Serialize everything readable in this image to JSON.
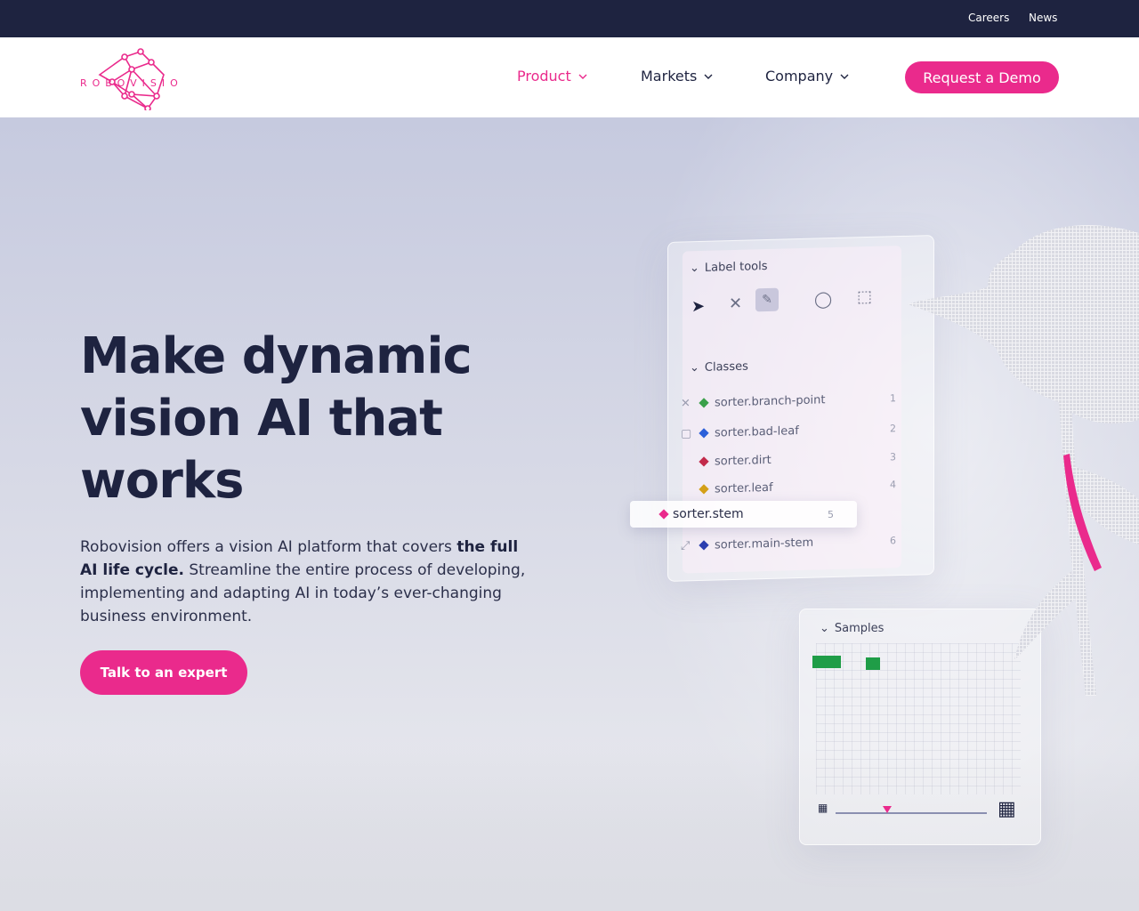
{
  "topbar": {
    "careers": "Careers",
    "news": "News"
  },
  "brand": {
    "name": "ROBOVISION",
    "accent_color": "#ea2a8c",
    "dark_color": "#1e2340"
  },
  "nav": {
    "product": "Product",
    "markets": "Markets",
    "company": "Company",
    "demo_button": "Request a Demo"
  },
  "hero": {
    "headline": "Make dynamic vision AI that works",
    "lead_start": "Robovision offers a vision AI platform that covers ",
    "lead_bold": "the full AI life cycle.",
    "lead_end": " Streamline the entire process of developing, implementing and adapting AI in today’s ever-changing business environment.",
    "cta": "Talk to an expert"
  },
  "ui_panel": {
    "label_tools_title": "Label tools",
    "classes_title": "Classes",
    "classes": [
      {
        "name": "sorter.branch-point",
        "num": "1",
        "color": "#3aa04a"
      },
      {
        "name": "sorter.bad-leaf",
        "num": "2",
        "color": "#2b5fd9"
      },
      {
        "name": "sorter.dirt",
        "num": "3",
        "color": "#c22a4a"
      },
      {
        "name": "sorter.leaf",
        "num": "4",
        "color": "#d4a017"
      }
    ],
    "selected_class": {
      "name": "sorter.stem",
      "num": "5",
      "color": "#ea2a8c"
    },
    "last_class": {
      "name": "sorter.main-stem",
      "num": "6",
      "color": "#2b3fb0"
    },
    "samples_title": "Samples"
  }
}
